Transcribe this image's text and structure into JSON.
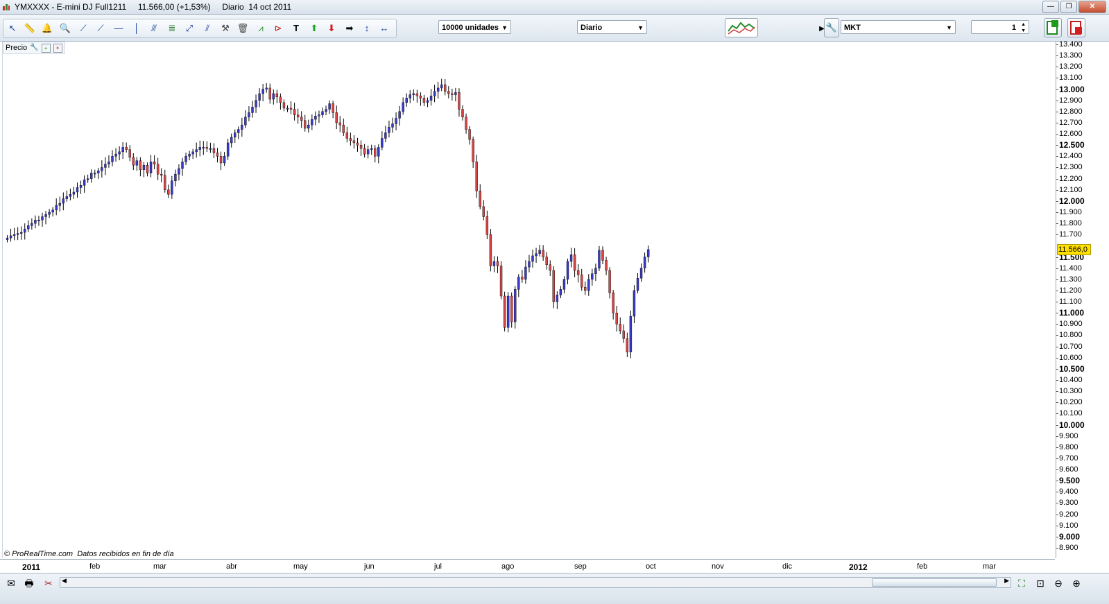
{
  "window": {
    "title": "YMXXXX - E-mini DJ Full1211     11.566,00 (+1,53%)     Diario  14 oct 2011",
    "buttons": [
      "minimize",
      "restore",
      "close"
    ]
  },
  "toolbar": {
    "tools": [
      "cursor-icon",
      "ruler-icon",
      "alarm-bell-icon",
      "zoom-icon",
      "trendline-icon",
      "ray-icon",
      "horizontal-line-icon",
      "vertical-line-icon",
      "fan-icon",
      "fibonacci-icon",
      "channel-icon",
      "parallel-lines-icon",
      "hammer-icon",
      "trash-icon",
      "chart-pattern-icon",
      "triangle-icon",
      "text-icon",
      "buy-arrow-icon",
      "sell-arrow-icon",
      "right-arrow-icon",
      "vertical-measure-icon",
      "horizontal-measure-icon"
    ],
    "units_select": "10000 unidades",
    "period_select": "Diario",
    "order_type_select": "MKT",
    "quantity_value": "1"
  },
  "chart_header": {
    "label": "Precio"
  },
  "footer_text": "© ProRealTime.com  Datos recibidos en fin de día",
  "current_price_badge": "11.566,0",
  "colors": {
    "up_candle": "#3a3acb",
    "down_candle": "#d84545",
    "badge": "#ffe000"
  },
  "y_axis": {
    "labels": [
      "13.400",
      "13.300",
      "13.200",
      "13.100",
      "13.000",
      "12.900",
      "12.800",
      "12.700",
      "12.600",
      "12.500",
      "12.400",
      "12.300",
      "12.200",
      "12.100",
      "12.000",
      "11.900",
      "11.800",
      "11.700",
      "11.500",
      "11.400",
      "11.300",
      "11.200",
      "11.100",
      "11.000",
      "10.900",
      "10.800",
      "10.700",
      "10.600",
      "10.500",
      "10.400",
      "10.300",
      "10.200",
      "10.100",
      "10.000",
      "9.900",
      "9.800",
      "9.700",
      "9.600",
      "9.500",
      "9.400",
      "9.300",
      "9.200",
      "9.100",
      "9.000",
      "8.900"
    ],
    "bold": [
      "13.000",
      "12.500",
      "12.000",
      "11.500",
      "11.000",
      "10.500",
      "10.000",
      "9.500",
      "9.000"
    ]
  },
  "x_axis": {
    "labels": [
      "2011",
      "feb",
      "mar",
      "abr",
      "may",
      "jun",
      "jul",
      "ago",
      "sep",
      "oct",
      "nov",
      "dic",
      "2012",
      "feb",
      "mar"
    ],
    "bold": [
      "2011",
      "2012"
    ]
  },
  "chart_data": {
    "type": "candlestick",
    "instrument": "YMXXXX - E-mini DJ Full1211",
    "last": 11566,
    "change_pct": 1.53,
    "ylim": [
      8850,
      13450
    ],
    "closes": [
      11670,
      11690,
      11700,
      11710,
      11720,
      11750,
      11780,
      11800,
      11830,
      11830,
      11860,
      11880,
      11900,
      11920,
      11960,
      11980,
      12020,
      12040,
      12060,
      12080,
      12120,
      12140,
      12190,
      12200,
      12250,
      12250,
      12270,
      12300,
      12330,
      12350,
      12400,
      12420,
      12440,
      12480,
      12460,
      12390,
      12320,
      12360,
      12280,
      12320,
      12250,
      12350,
      12330,
      12240,
      12230,
      12100,
      12060,
      12180,
      12240,
      12290,
      12350,
      12400,
      12420,
      12440,
      12460,
      12480,
      12480,
      12470,
      12470,
      12430,
      12400,
      12340,
      12400,
      12520,
      12570,
      12610,
      12640,
      12680,
      12750,
      12790,
      12840,
      12900,
      12960,
      13000,
      13010,
      12910,
      12960,
      12930,
      12880,
      12830,
      12830,
      12820,
      12770,
      12750,
      12720,
      12650,
      12680,
      12730,
      12760,
      12770,
      12800,
      12820,
      12870,
      12790,
      12700,
      12680,
      12610,
      12560,
      12540,
      12520,
      12500,
      12470,
      12420,
      12460,
      12470,
      12400,
      12480,
      12560,
      12610,
      12660,
      12690,
      12740,
      12800,
      12880,
      12920,
      12950,
      12960,
      12940,
      12920,
      12880,
      12900,
      12940,
      12980,
      13010,
      13040,
      12980,
      12960,
      12950,
      12970,
      12820,
      12750,
      12640,
      12550,
      12350,
      12090,
      11950,
      11860,
      11700,
      11420,
      11460,
      11420,
      11150,
      10870,
      11150,
      10920,
      11210,
      11320,
      11300,
      11410,
      11460,
      11510,
      11530,
      11560,
      11500,
      11430,
      11380,
      11100,
      11160,
      11210,
      11300,
      11460,
      11520,
      11380,
      11340,
      11230,
      11200,
      11300,
      11350,
      11400,
      11560,
      11470,
      11380,
      11180,
      11000,
      10900,
      10840,
      10770,
      10650,
      10970,
      11200,
      11310,
      11400,
      11500,
      11566
    ]
  }
}
